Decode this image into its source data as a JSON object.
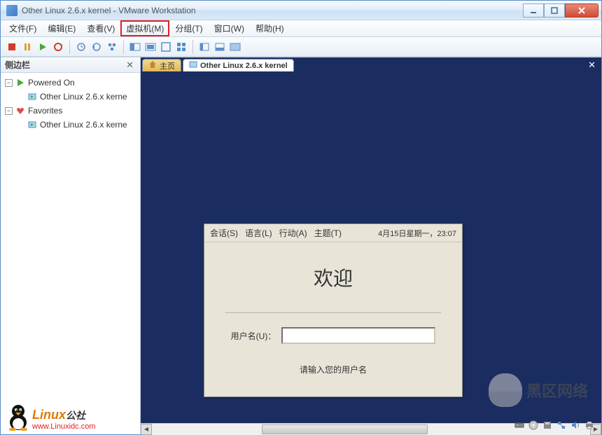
{
  "window": {
    "title": "Other Linux 2.6.x kernel - VMware Workstation"
  },
  "menu": {
    "file": "文件(F)",
    "edit": "编辑(E)",
    "view": "查看(V)",
    "vm": "虚拟机(M)",
    "group": "分组(T)",
    "window": "窗口(W)",
    "help": "帮助(H)"
  },
  "sidebar": {
    "title": "侧边栏",
    "powered_on": "Powered On",
    "vm1": "Other Linux 2.6.x kerne",
    "favorites": "Favorites",
    "vm2": "Other Linux 2.6.x kerne"
  },
  "tabs": {
    "home_label": "主页",
    "active_label": "Other Linux 2.6.x kernel"
  },
  "login": {
    "menu_session": "会话(S)",
    "menu_lang": "语言(L)",
    "menu_action": "行动(A)",
    "menu_theme": "主题(T)",
    "datetime": "4月15日星期一，23:07",
    "welcome": "欢迎",
    "username_label": "用户名(U)：",
    "hint": "请输入您的用户名"
  },
  "watermark": {
    "linux_text": "Linux",
    "linux_suffix": "公社",
    "linux_url": "www.Linuxidc.com",
    "right_text": "黑区网络"
  }
}
